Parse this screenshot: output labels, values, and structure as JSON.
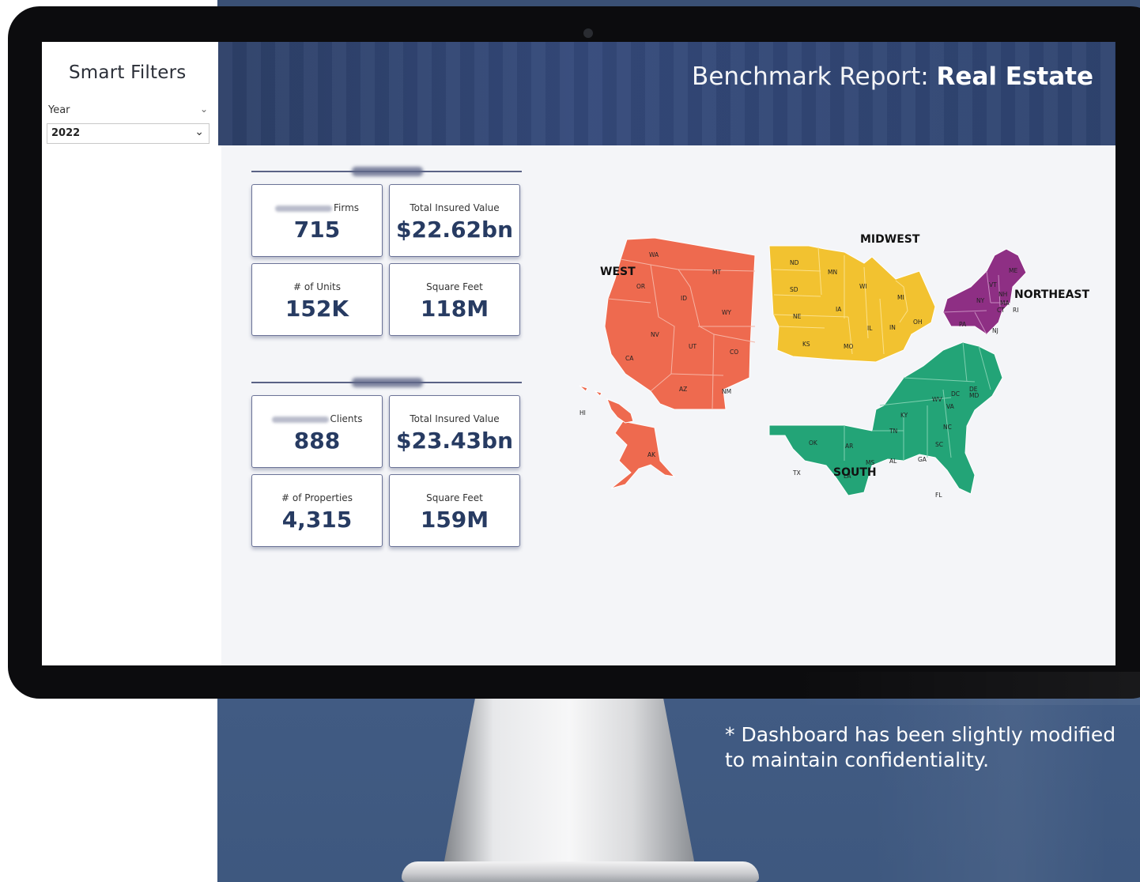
{
  "sidebar": {
    "title": "Smart Filters",
    "filter_label": "Year",
    "filter_value": "2022"
  },
  "header": {
    "title_light": "Benchmark Report: ",
    "title_bold": "Real Estate"
  },
  "habitational": {
    "kpis": [
      {
        "label": "Firms",
        "value": "715"
      },
      {
        "label": "Total Insured Value",
        "value": "$22.62bn"
      },
      {
        "label": "# of Units",
        "value": "152K"
      },
      {
        "label": "Square Feet",
        "value": "118M"
      }
    ]
  },
  "commercial": {
    "kpis": [
      {
        "label": "Clients",
        "value": "888"
      },
      {
        "label": "Total Insured Value",
        "value": "$23.43bn"
      },
      {
        "label": "# of Properties",
        "value": "4,315"
      },
      {
        "label": "Square Feet",
        "value": "159M"
      }
    ]
  },
  "map": {
    "regions": [
      {
        "name": "WEST",
        "color": "#ee6a4f"
      },
      {
        "name": "MIDWEST",
        "color": "#f2c230"
      },
      {
        "name": "NORTHEAST",
        "color": "#8e2f84"
      },
      {
        "name": "SOUTH",
        "color": "#23a477"
      }
    ],
    "states": {
      "west": [
        "WA",
        "OR",
        "CA",
        "MT",
        "ID",
        "WY",
        "NV",
        "UT",
        "CO",
        "AZ",
        "NM",
        "AK",
        "HI"
      ],
      "midwest": [
        "ND",
        "SD",
        "NE",
        "KS",
        "MN",
        "IA",
        "MO",
        "WI",
        "IL",
        "MI",
        "IN",
        "OH"
      ],
      "northeast": [
        "ME",
        "VT",
        "NH",
        "NY",
        "MA",
        "CT",
        "RI",
        "PA",
        "NJ"
      ],
      "south": [
        "OK",
        "TX",
        "AR",
        "LA",
        "MS",
        "AL",
        "TN",
        "KY",
        "WV",
        "VA",
        "DC",
        "DE",
        "MD",
        "NC",
        "SC",
        "GA",
        "FL"
      ]
    }
  },
  "disclaimer": "* Dashboard has been slightly modified to maintain confidentiality."
}
